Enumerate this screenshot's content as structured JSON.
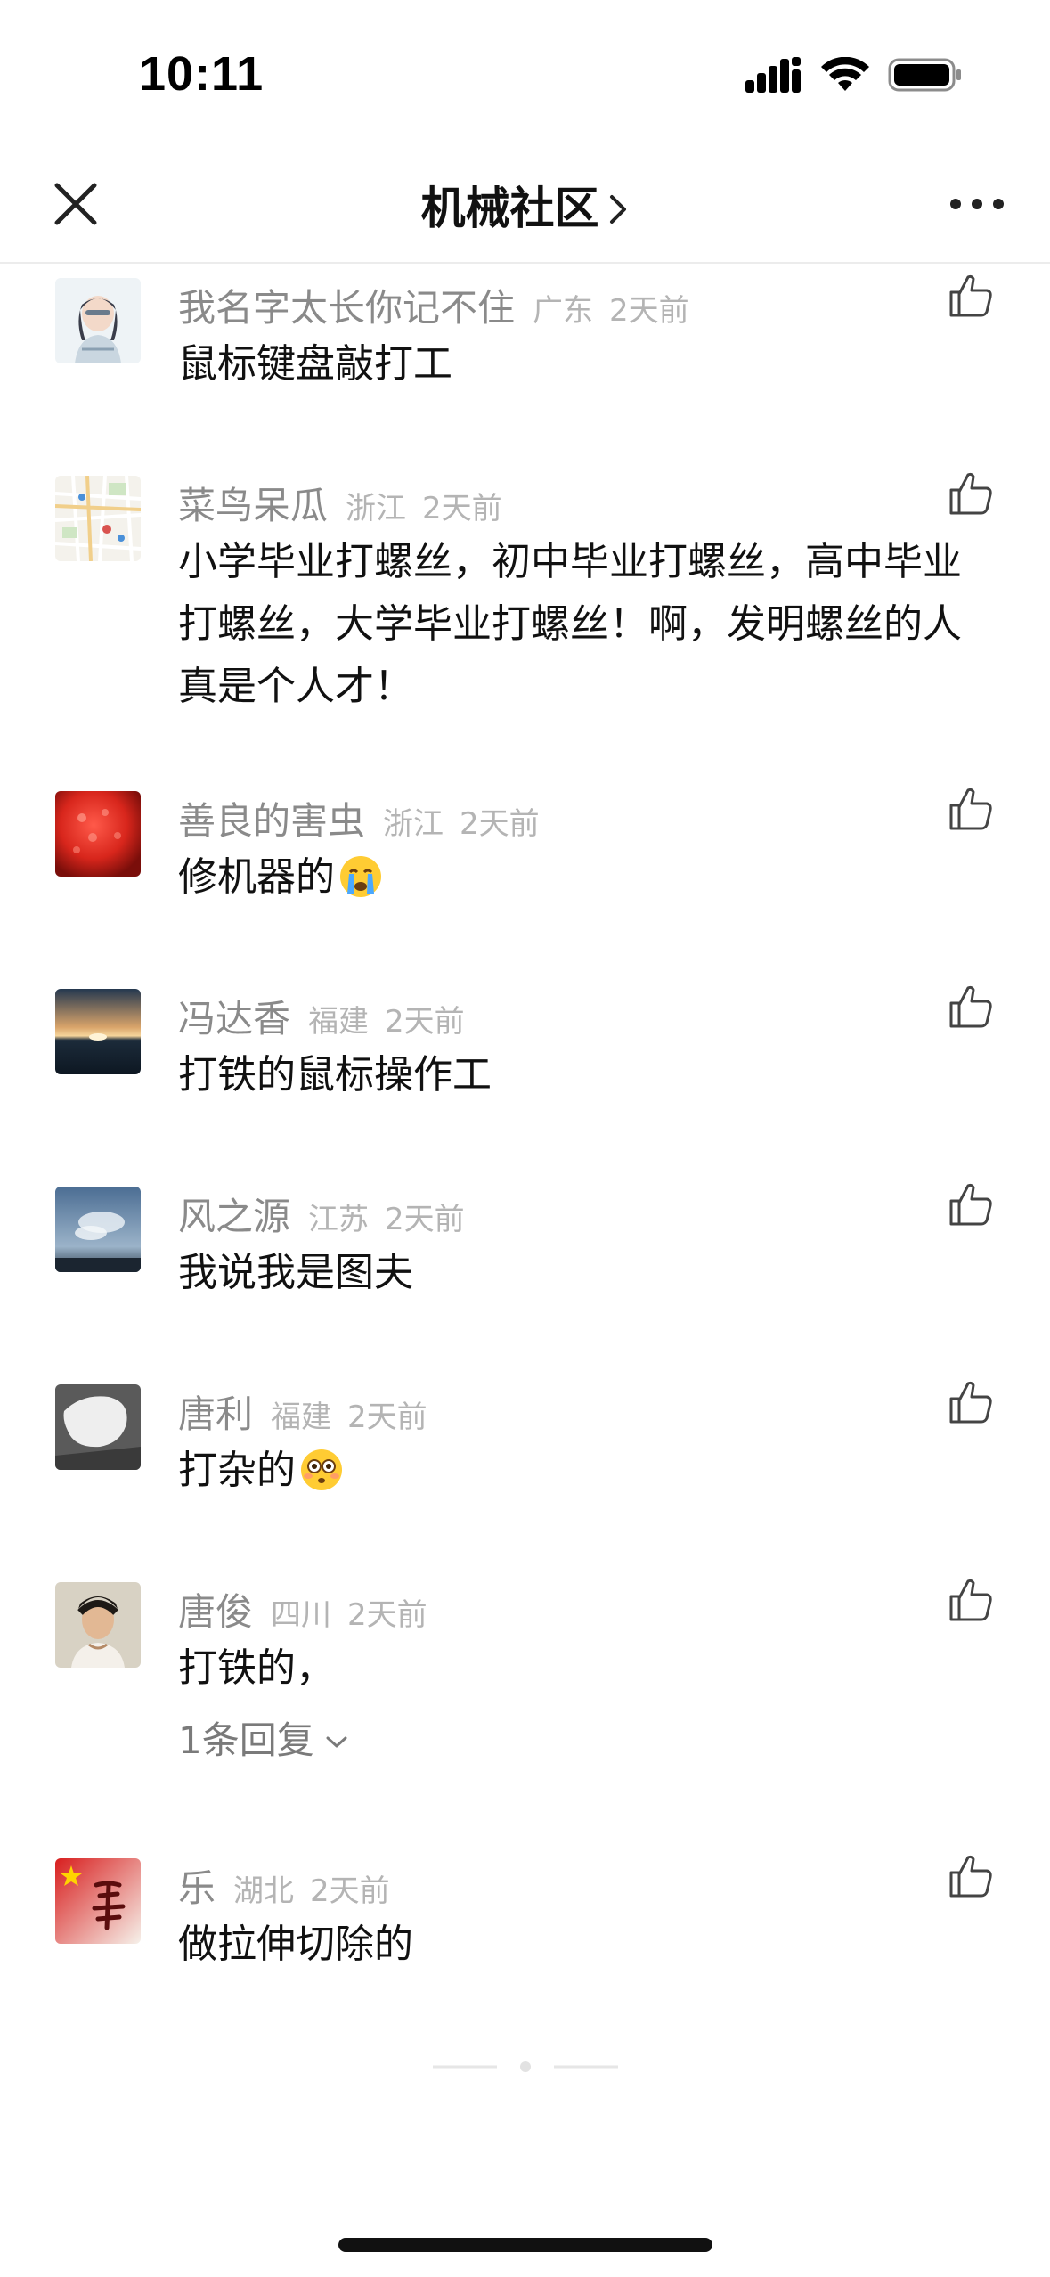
{
  "status_bar": {
    "time": "10:11",
    "icons": [
      "cellular-signal-icon",
      "wifi-icon",
      "battery-icon"
    ]
  },
  "nav": {
    "back_icon": "close-icon",
    "title": "机械社区",
    "title_icon": "chevron-right-icon",
    "more_icon": "more-horizontal-icon"
  },
  "comments": [
    {
      "name": "我名字太长你记不住",
      "location": "广东",
      "time": "2天前",
      "text": "鼠标键盘敲打工"
    },
    {
      "name": "菜鸟呆瓜",
      "location": "浙江",
      "time": "2天前",
      "text": "小学毕业打螺丝，初中毕业打螺丝，高中毕业打螺丝，大学毕业打螺丝！啊，发明螺丝的人真是个人才！"
    },
    {
      "name": "善良的害虫",
      "location": "浙江",
      "time": "2天前",
      "text": "修机器的",
      "emoji": "crying-face-emoji"
    },
    {
      "name": "冯达香",
      "location": "福建",
      "time": "2天前",
      "text": "打铁的鼠标操作工"
    },
    {
      "name": "风之源",
      "location": "江苏",
      "time": "2天前",
      "text": "我说我是图夫"
    },
    {
      "name": "唐利",
      "location": "福建",
      "time": "2天前",
      "text": "打杂的",
      "emoji": "flushed-face-emoji"
    },
    {
      "name": "唐俊",
      "location": "四川",
      "time": "2天前",
      "text": "打铁的，",
      "reply_label": "1条回复"
    },
    {
      "name": "乐",
      "location": "湖北",
      "time": "2天前",
      "text": "做拉伸切除的"
    }
  ],
  "colors": {
    "name": "#8a8a8a",
    "meta": "#b4b4b4",
    "text": "#111111",
    "divider": "#ececec"
  }
}
